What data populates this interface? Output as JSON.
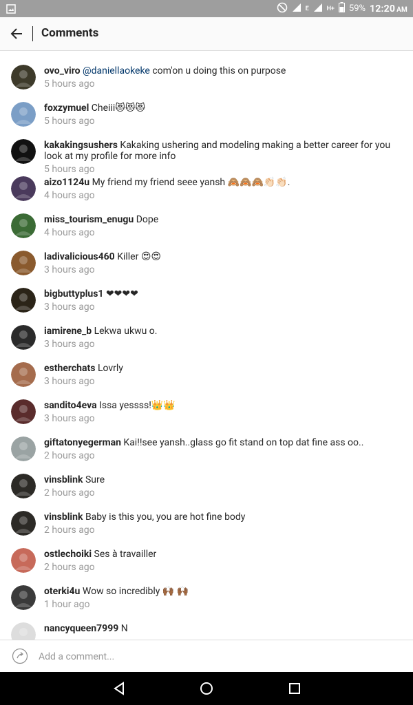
{
  "status_bar": {
    "battery": "59%",
    "time": "12:20",
    "ampm": "AM",
    "network_e": "E",
    "network_h": "H+"
  },
  "header": {
    "title": "Comments",
    "back_icon": "back-arrow-icon"
  },
  "comments": [
    {
      "username": "ovo_viro",
      "mention": "@daniellaokeke",
      "text": " com'on u doing this on purpose",
      "time": "5 hours ago",
      "avatar_color": "#3d3a2a"
    },
    {
      "username": "foxzymuel",
      "mention": "",
      "text": "Cheiii😻😻😻",
      "time": "5 hours ago",
      "avatar_color": "#7b9ec6"
    },
    {
      "username": "kakakingsushers",
      "mention": "",
      "text": "Kakaking ushering and modeling making a better career for you look at my profile for more info",
      "time": "5 hours ago",
      "avatar_color": "#111111"
    },
    {
      "username": "aizo1124u",
      "mention": "",
      "text": "My friend my friend seee yansh 🙈🙈🙈👏🏻👏🏻.",
      "time": "4 hours ago",
      "avatar_color": "#4a3a5c"
    },
    {
      "username": "miss_tourism_enugu",
      "mention": "",
      "text": "Dope",
      "time": "4 hours ago",
      "avatar_color": "#3b6b35"
    },
    {
      "username": "ladivalicious460",
      "mention": "",
      "text": "Killer 😍😍",
      "time": "3 hours ago",
      "avatar_color": "#8a5a2e"
    },
    {
      "username": "bigbuttyplus1",
      "mention": "",
      "text": "❤❤❤❤",
      "time": "3 hours ago",
      "avatar_color": "#2b2418"
    },
    {
      "username": "iamirene_b",
      "mention": "",
      "text": "Lekwa ukwu o.",
      "time": "3 hours ago",
      "avatar_color": "#2a2a2a"
    },
    {
      "username": "estherchats",
      "mention": "",
      "text": "Lovrly",
      "time": "3 hours ago",
      "avatar_color": "#a56c4d"
    },
    {
      "username": "sandito4eva",
      "mention": "",
      "text": "Issa yessss!👑👑",
      "time": "3 hours ago",
      "avatar_color": "#5a2c2c"
    },
    {
      "username": "giftatonyegerman",
      "mention": "",
      "text": "Kai!!see yansh..glass go fit stand on top dat fine ass oo..",
      "time": "2 hours ago",
      "avatar_color": "#9aa3a3"
    },
    {
      "username": "vinsblink",
      "mention": "",
      "text": "Sure",
      "time": "2 hours ago",
      "avatar_color": "#2c2a26"
    },
    {
      "username": "vinsblink",
      "mention": "",
      "text": "Baby is this you, you are hot fine body",
      "time": "2 hours ago",
      "avatar_color": "#2c2a26"
    },
    {
      "username": "ostlechoiki",
      "mention": "",
      "text": "Ses à travailler",
      "time": "2 hours ago",
      "avatar_color": "#c76a5a"
    },
    {
      "username": "oterki4u",
      "mention": "",
      "text": "Wow so incredibly 🙌🏾 🙌🏾",
      "time": "1 hour ago",
      "avatar_color": "#3a3a3a"
    },
    {
      "username": "nancyqueen7999",
      "mention": "",
      "text": "N",
      "time": "",
      "avatar_color": "#dddddd"
    }
  ],
  "add_comment": {
    "placeholder": "Add a comment..."
  },
  "nav_bar": {
    "back_icon": "triangle-back-icon",
    "home_icon": "circle-home-icon",
    "recents_icon": "square-recents-icon"
  }
}
